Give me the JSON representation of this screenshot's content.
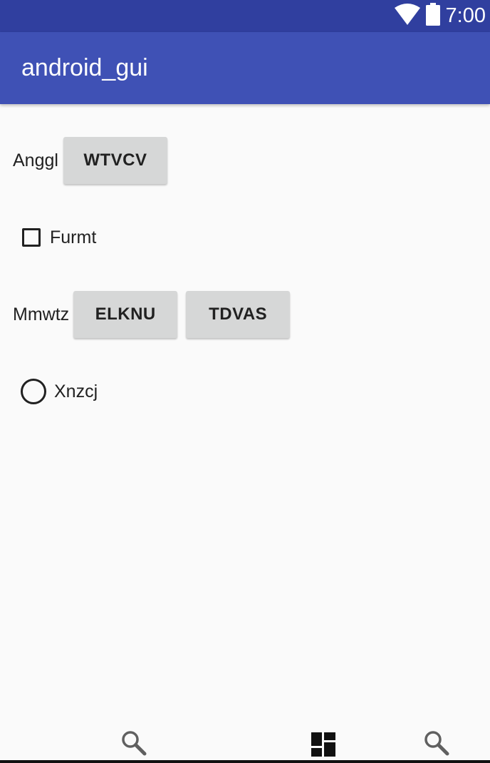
{
  "status_bar": {
    "time": "7:00",
    "wifi_icon": "wifi-icon",
    "battery_icon": "battery-icon"
  },
  "app_bar": {
    "title": "android_gui"
  },
  "row1": {
    "label": "Anggl",
    "button": "WTVCV"
  },
  "checkbox": {
    "label": "Furmt",
    "checked": false
  },
  "row2": {
    "label": "Mmwtz",
    "button1": "ELKNU",
    "button2": "TDVAS"
  },
  "radio": {
    "label": "Xnzcj",
    "selected": false
  },
  "bottom_nav": {
    "icons": [
      "search-icon",
      "dashboard-icon",
      "search-icon"
    ]
  },
  "colors": {
    "status_bar": "#303f9f",
    "app_bar": "#3f51b5",
    "background": "#fafafa",
    "button": "#d6d7d7",
    "text": "#212121"
  }
}
